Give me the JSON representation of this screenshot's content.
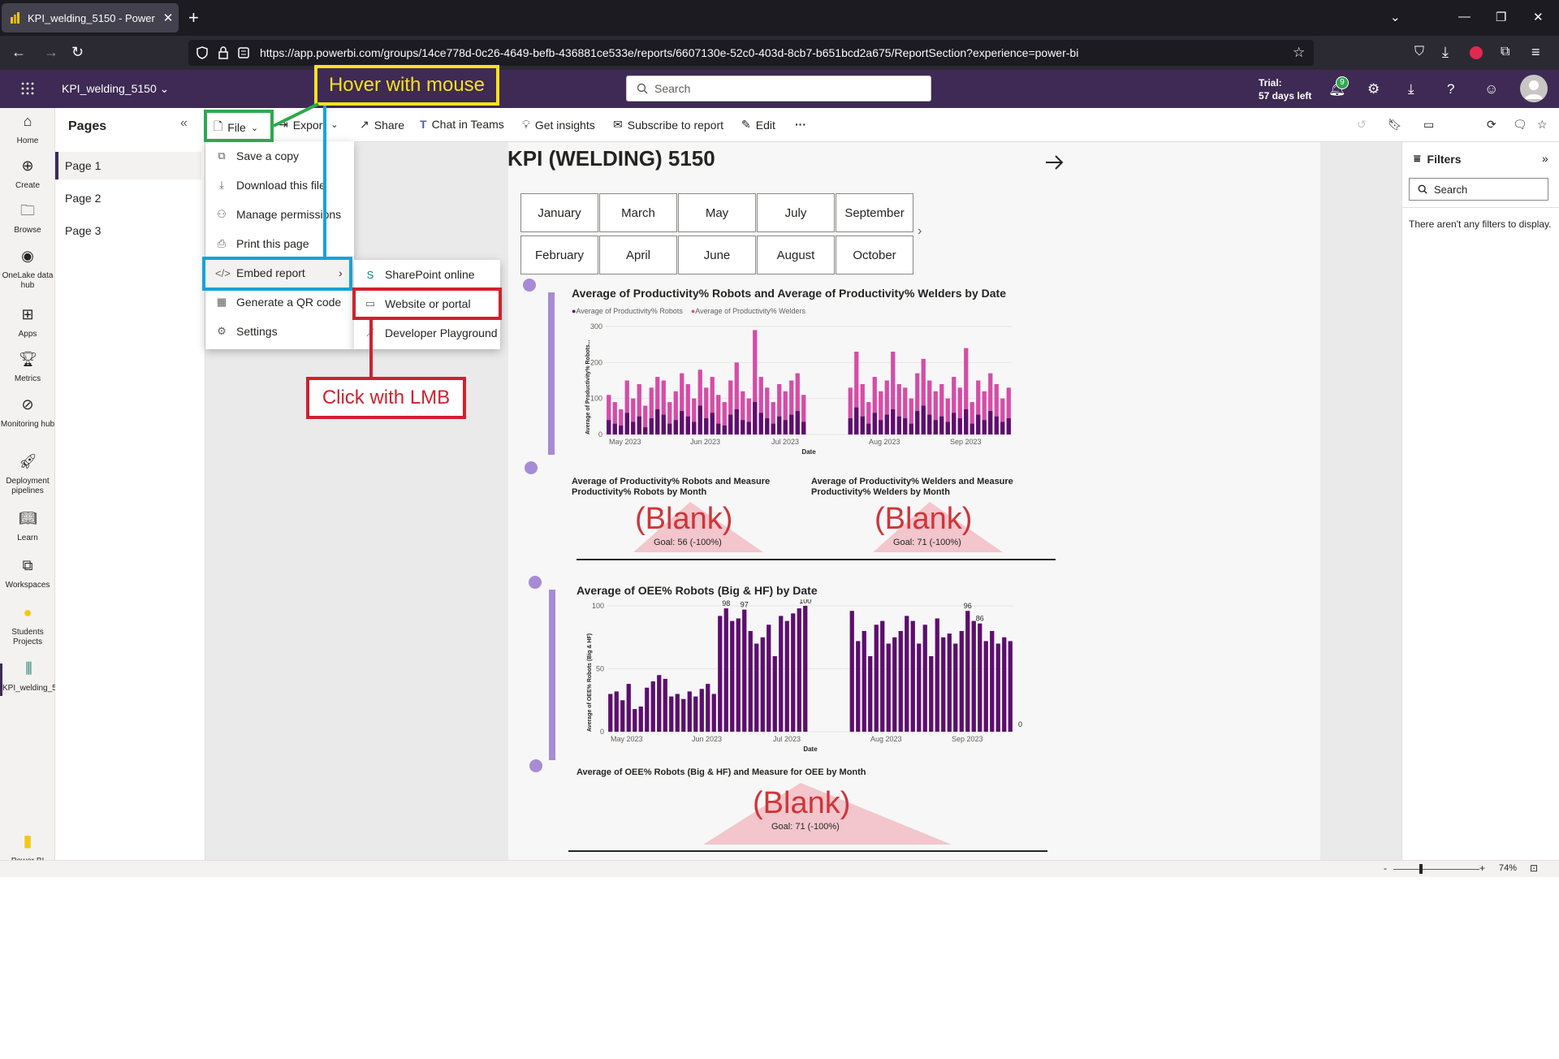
{
  "browser": {
    "tab_title": "KPI_welding_5150 - Power BI",
    "url": "https://app.powerbi.com/groups/14ce778d-0c26-4649-befb-436881ce533e/reports/6607130e-52c0-403d-8cb7-b651bcd2a675/ReportSection?experience=power-bi"
  },
  "header": {
    "app_name": "KPI_welding_5150",
    "search_placeholder": "Search",
    "trial_line1": "Trial:",
    "trial_line2": "57 days left",
    "notification_count": "9"
  },
  "leftnav": [
    {
      "label": "Home",
      "icon": "home-icon"
    },
    {
      "label": "Create",
      "icon": "plus-circle-icon"
    },
    {
      "label": "Browse",
      "icon": "folder-icon"
    },
    {
      "label": "OneLake data hub",
      "icon": "onelake-icon"
    },
    {
      "label": "Apps",
      "icon": "apps-icon"
    },
    {
      "label": "Metrics",
      "icon": "trophy-icon"
    },
    {
      "label": "Monitoring hub",
      "icon": "monitoring-icon"
    },
    {
      "label": "Deployment pipelines",
      "icon": "rocket-icon"
    },
    {
      "label": "Learn",
      "icon": "book-icon"
    },
    {
      "label": "Workspaces",
      "icon": "workspaces-icon"
    },
    {
      "label": "Students Projects",
      "icon": "workspace-avatar-icon"
    },
    {
      "label": "KPI_welding_5150",
      "icon": "report-icon"
    }
  ],
  "powerbi_label": "Power BI",
  "pages": {
    "title": "Pages",
    "items": [
      "Page 1",
      "Page 2",
      "Page 3"
    ]
  },
  "toolbar": {
    "file": "File",
    "export": "Export",
    "share": "Share",
    "chat": "Chat in Teams",
    "insights": "Get insights",
    "subscribe": "Subscribe to report",
    "edit": "Edit",
    "more": "···"
  },
  "file_menu": [
    "Save a copy",
    "Download this file",
    "Manage permissions",
    "Print this page",
    "Embed report",
    "Generate a QR code",
    "Settings"
  ],
  "embed_menu": [
    "SharePoint online",
    "Website or portal",
    "Developer Playground"
  ],
  "annotations": {
    "hover": "Hover with mouse",
    "click": "Click with LMB"
  },
  "report": {
    "title": "KPI (WELDING) 5150",
    "months_row1": [
      "January",
      "March",
      "May",
      "July",
      "September"
    ],
    "months_row2": [
      "February",
      "April",
      "June",
      "August",
      "October"
    ],
    "chart1_title": "Average of Productivity% Robots and Average of Productivity% Welders by Date",
    "chart1_legend1": "Average of Productivity% Robots",
    "chart1_legend2": "Average of Productivity% Welders",
    "chart1_ylabel": "Average of Productivity% Robots...",
    "chart1_xlabel": "Date",
    "kpi1_title": "Average of Productivity% Robots and Measure Productivity% Robots by Month",
    "kpi2_title": "Average of Productivity% Welders and Measure Productivity% Welders by Month",
    "blank": "(Blank)",
    "kpi1_goal": "Goal: 56 (-100%)",
    "kpi2_goal": "Goal: 71 (-100%)",
    "chart2_title": "Average of OEE% Robots (Big & HF) by Date",
    "chart2_ylabel": "Average of OEE% Robots (Big & HF)",
    "chart2_xlabel": "Date",
    "kpi3_title": "Average of OEE% Robots (Big & HF) and Measure for OEE by Month",
    "kpi3_goal": "Goal: 71 (-100%)"
  },
  "filters": {
    "title": "Filters",
    "search": "Search",
    "empty": "There aren't any filters to display."
  },
  "status": {
    "zoom": "74%"
  },
  "chart_data": [
    {
      "type": "bar",
      "title": "Average of Productivity% Robots and Average of Productivity% Welders by Date",
      "xlabel": "Date",
      "ylabel": "Average of Productivity% Robots...",
      "ylim": [
        0,
        300
      ],
      "yticks": [
        "0",
        "100",
        "200",
        "300"
      ],
      "xticks": [
        "May 2023",
        "Jun 2023",
        "Jul 2023",
        "Aug 2023",
        "Sep 2023"
      ],
      "series": [
        {
          "name": "Average of Productivity% Robots",
          "color": "#5c0e6e",
          "values": [
            40,
            30,
            25,
            60,
            35,
            50,
            20,
            45,
            70,
            55,
            30,
            40,
            65,
            50,
            35,
            80,
            45,
            60,
            30,
            25,
            55,
            70,
            40,
            35,
            90,
            60,
            45,
            30,
            50,
            40,
            55,
            65,
            35,
            45,
            75,
            50,
            30,
            60,
            40,
            55,
            70,
            50,
            45,
            30,
            65,
            80,
            55,
            40,
            50,
            35,
            60,
            45,
            70,
            30,
            55,
            40,
            65,
            50,
            35,
            45
          ]
        },
        {
          "name": "Average of Productivity% Welders",
          "color": "#d64ca7",
          "values": [
            110,
            90,
            70,
            150,
            100,
            140,
            80,
            130,
            160,
            150,
            90,
            120,
            170,
            140,
            100,
            180,
            130,
            160,
            110,
            90,
            150,
            200,
            120,
            100,
            290,
            160,
            130,
            90,
            140,
            120,
            150,
            170,
            110,
            130,
            230,
            140,
            90,
            160,
            120,
            150,
            230,
            140,
            130,
            100,
            170,
            210,
            150,
            120,
            140,
            100,
            160,
            130,
            240,
            90,
            150,
            120,
            170,
            140,
            100,
            130
          ]
        }
      ]
    },
    {
      "type": "bar",
      "title": "Average of OEE% Robots (Big & HF) by Date",
      "xlabel": "Date",
      "ylabel": "Average of OEE% Robots (Big & HF)",
      "ylim": [
        0,
        100
      ],
      "yticks": [
        "0",
        "50",
        "100"
      ],
      "xticks": [
        "May 2023",
        "Jun 2023",
        "Jul 2023",
        "Aug 2023",
        "Sep 2023"
      ],
      "data_labels": [
        "98",
        "97",
        "100",
        "96",
        "86",
        "0"
      ],
      "series": [
        {
          "name": "",
          "color": "#5c0e6e",
          "values": [
            30,
            32,
            25,
            38,
            18,
            20,
            35,
            40,
            45,
            42,
            28,
            30,
            26,
            32,
            28,
            34,
            38,
            30,
            92,
            98,
            88,
            90,
            97,
            80,
            70,
            75,
            85,
            60,
            92,
            88,
            94,
            98,
            100,
            96,
            72,
            80,
            60,
            85,
            88,
            70,
            75,
            80,
            92,
            88,
            70,
            85,
            60,
            90,
            75,
            78,
            70,
            80,
            96,
            88,
            86,
            72,
            80,
            70,
            75,
            72
          ]
        }
      ]
    }
  ]
}
